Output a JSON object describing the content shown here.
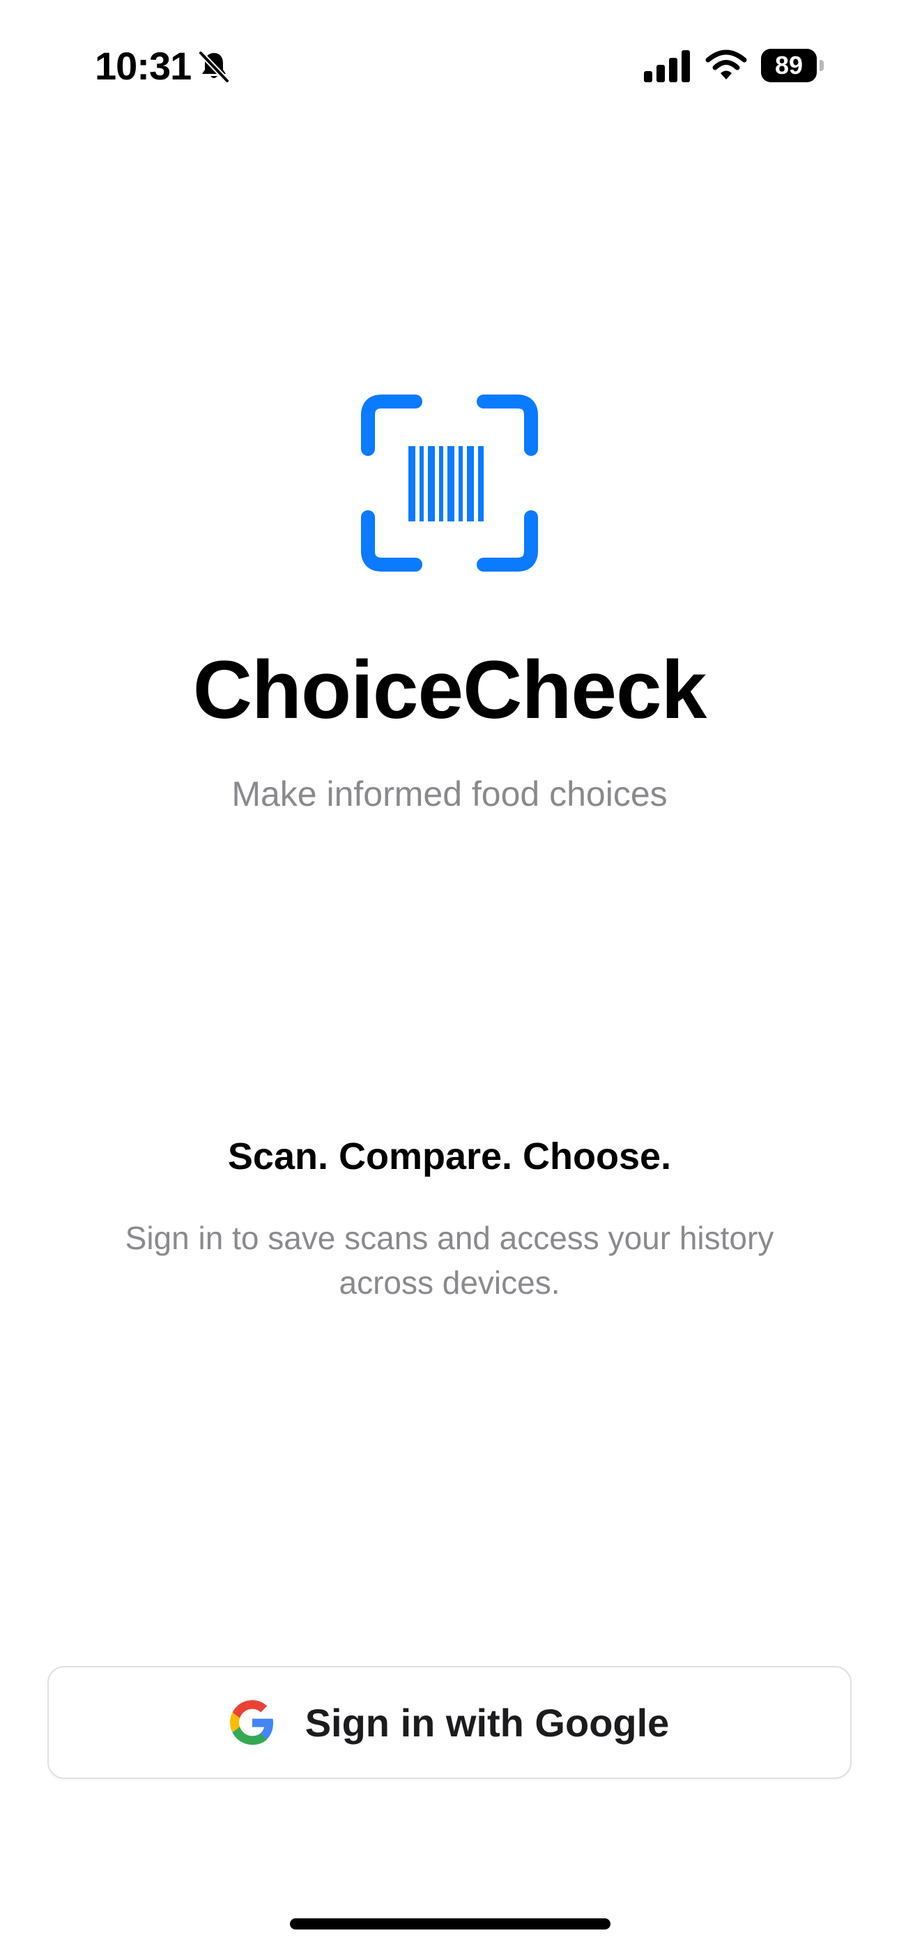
{
  "status_bar": {
    "time": "10:31",
    "battery": "89",
    "icons": [
      "bell-slash-icon",
      "cellular-signal-icon",
      "wifi-icon",
      "battery-icon"
    ]
  },
  "app": {
    "logo_icon": "barcode-scanner-icon",
    "title": "ChoiceCheck",
    "subtitle": "Make informed food choices"
  },
  "intro": {
    "tagline": "Scan. Compare. Choose.",
    "description": "Sign in to save scans and access your history across devices."
  },
  "auth": {
    "google_button_label": "Sign in with Google",
    "google_icon": "google-g-icon"
  },
  "colors": {
    "accent": "#0A7AFF",
    "secondary_text": "#8A8A8E",
    "background": "#FFFFFF"
  }
}
